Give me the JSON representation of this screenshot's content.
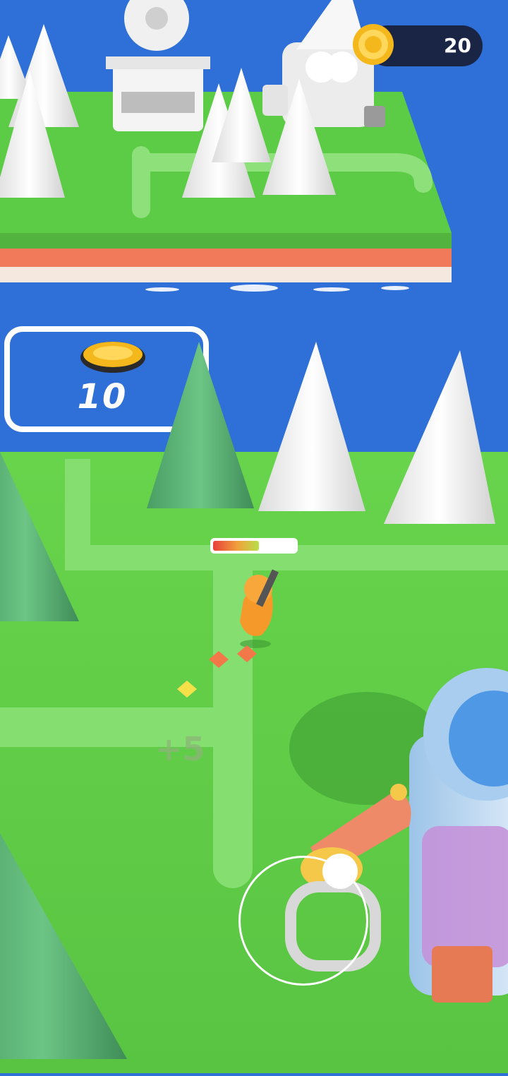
{
  "hud": {
    "coin_count": "20",
    "coin_icon": "gold-coin-icon"
  },
  "purchase_pad": {
    "price": "10",
    "icon": "gold-coin-icon"
  },
  "floating_text": {
    "gain": "+5"
  },
  "player": {
    "health": 0.56
  },
  "colors": {
    "water": "#2f6fd8",
    "grass": "#63d24a",
    "pine_green": "#4caf6a",
    "snow_white": "#f2f2f2",
    "player_orange": "#f59a2a",
    "coin_gold": "#f5b81c",
    "hud_bg": "#1a2444"
  }
}
